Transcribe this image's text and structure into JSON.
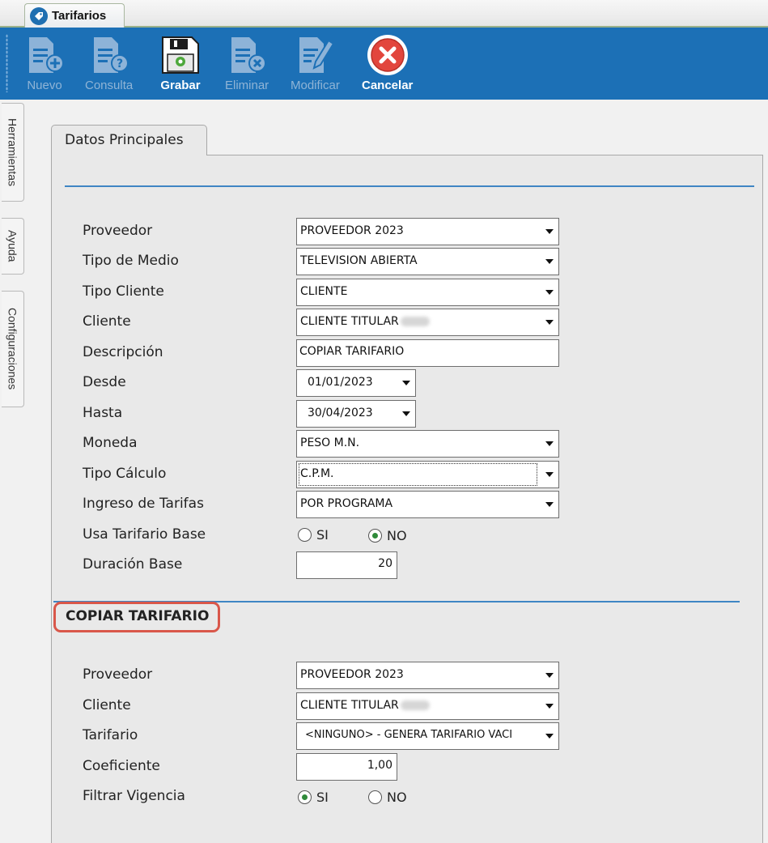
{
  "app": {
    "tab_title": "Tarifarios",
    "tab_icon": "tarifarios-app-icon"
  },
  "toolbar": {
    "buttons": [
      {
        "label": "Nuevo",
        "icon": "new-document-icon",
        "enabled": false
      },
      {
        "label": "Consulta",
        "icon": "query-document-icon",
        "enabled": false
      },
      {
        "label": "Grabar",
        "icon": "save-icon",
        "enabled": true
      },
      {
        "label": "Eliminar",
        "icon": "delete-document-icon",
        "enabled": false
      },
      {
        "label": "Modificar",
        "icon": "edit-document-icon",
        "enabled": false
      },
      {
        "label": "Cancelar",
        "icon": "cancel-icon",
        "enabled": true
      }
    ]
  },
  "side_tabs": [
    "Herramientas",
    "Ayuda",
    "Configuraciones"
  ],
  "form": {
    "tab_label": "Datos Principales",
    "fields": {
      "proveedor": {
        "label": "Proveedor",
        "value": "PROVEEDOR 2023"
      },
      "tipo_medio": {
        "label": "Tipo de Medio",
        "value": "TELEVISION ABIERTA"
      },
      "tipo_cliente": {
        "label": "Tipo Cliente",
        "value": "CLIENTE"
      },
      "cliente": {
        "label": "Cliente",
        "value": "CLIENTE TITULAR"
      },
      "descripcion": {
        "label": "Descripción",
        "value": "COPIAR TARIFARIO"
      },
      "desde": {
        "label": "Desde",
        "value": "01/01/2023"
      },
      "hasta": {
        "label": "Hasta",
        "value": "30/04/2023"
      },
      "moneda": {
        "label": "Moneda",
        "value": "PESO M.N."
      },
      "tipo_calculo": {
        "label": "Tipo Cálculo",
        "value": "C.P.M."
      },
      "ingreso_tarifas": {
        "label": "Ingreso de Tarifas",
        "value": "POR PROGRAMA"
      },
      "usa_tarifario_base": {
        "label": "Usa Tarifario Base",
        "options": [
          "SI",
          "NO"
        ],
        "selected": "NO"
      },
      "duracion_base": {
        "label": "Duración Base",
        "value": "20"
      }
    }
  },
  "copiar": {
    "title": "COPIAR TARIFARIO",
    "fields": {
      "proveedor": {
        "label": "Proveedor",
        "value": "PROVEEDOR 2023"
      },
      "cliente": {
        "label": "Cliente",
        "value": "CLIENTE TITULAR"
      },
      "tarifario": {
        "label": "Tarifario",
        "value": "<NINGUNO> - GENERA TARIFARIO VACI"
      },
      "coeficiente": {
        "label": "Coeficiente",
        "value": "1,00"
      },
      "filtrar_vigencia": {
        "label": "Filtrar Vigencia",
        "options": [
          "SI",
          "NO"
        ],
        "selected": "SI"
      }
    }
  },
  "colors": {
    "toolbar": "#1c70b6",
    "separator": "#3f86c4",
    "highlight": "#d9574a",
    "radio_dot": "#2f8a3a"
  }
}
